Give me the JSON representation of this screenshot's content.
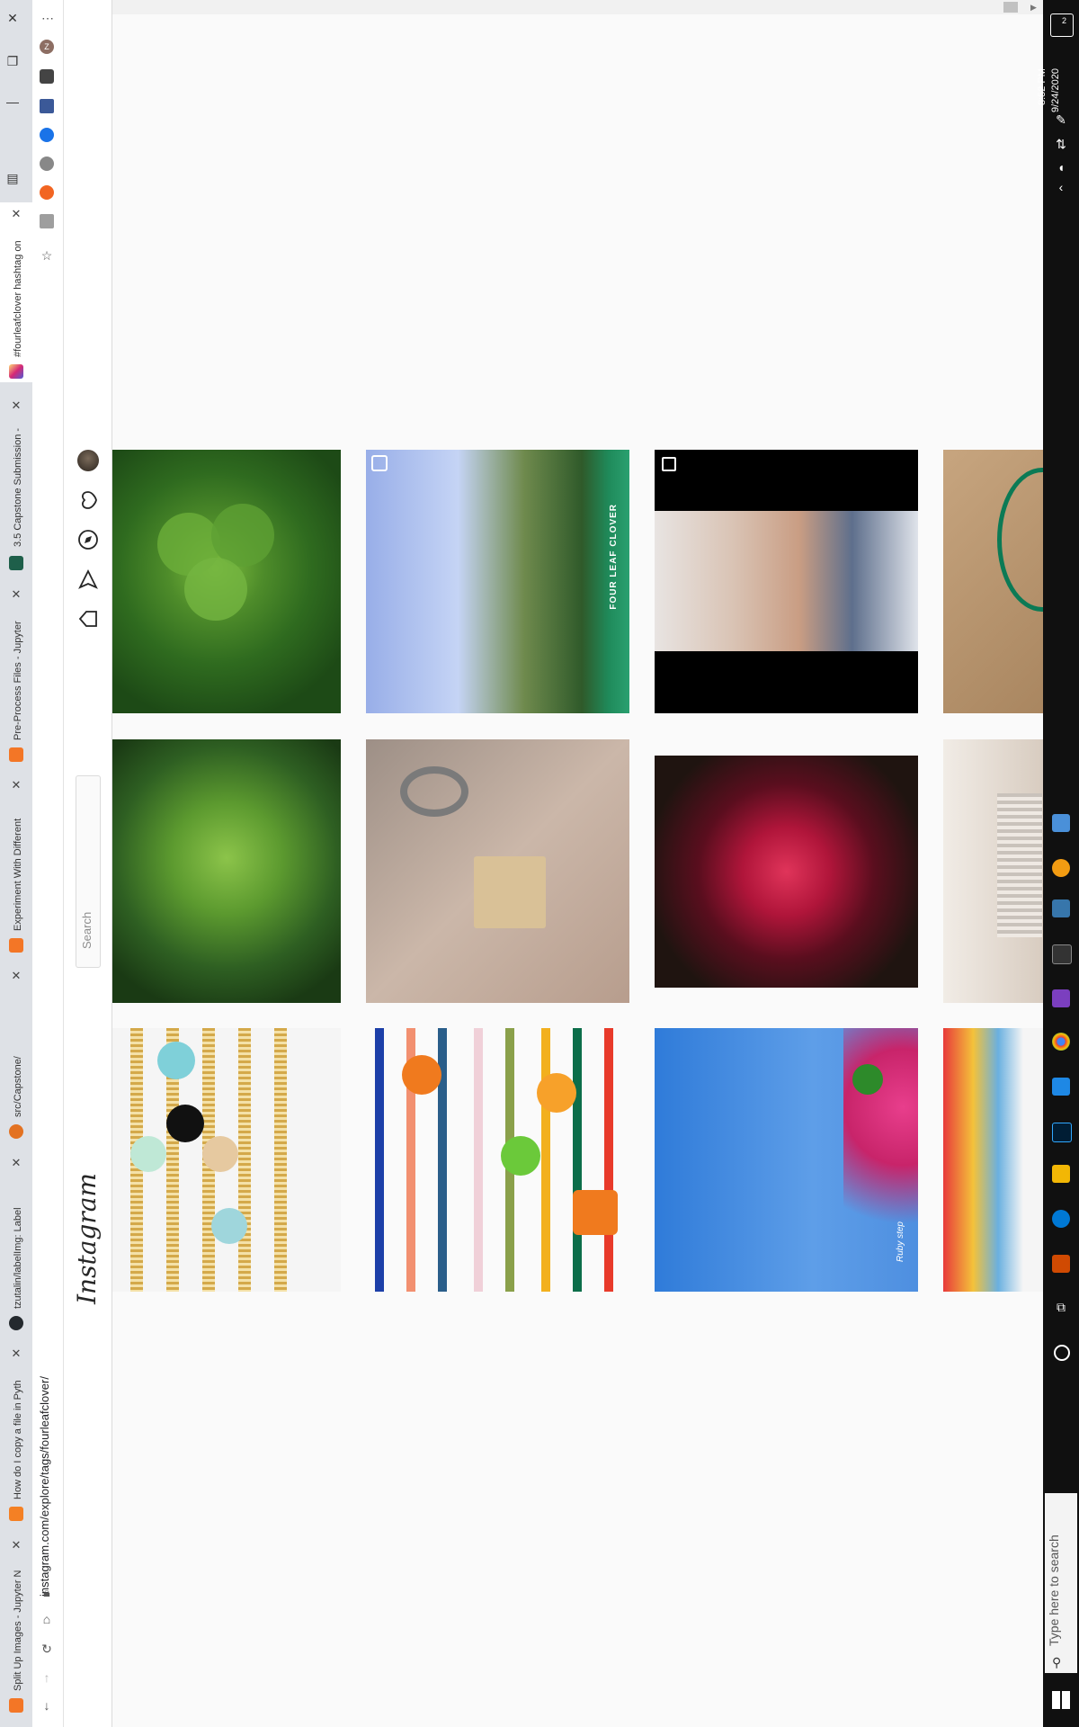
{
  "browser": {
    "tabs": [
      {
        "title": "Split Up Images - Jupyter N"
      },
      {
        "title": "How do I copy a file in Pyth"
      },
      {
        "title": "tzutalin/labelImg: Label"
      },
      {
        "title": "src/Capstone/"
      },
      {
        "title": "Experiment With Different"
      },
      {
        "title": "Pre-Process Files - Jupyter"
      },
      {
        "title": "3.5 Capstone Submission -"
      },
      {
        "title": "#fourleafclover hashtag on"
      }
    ],
    "url": "instagram.com/explore/tags/fourleafclover/",
    "profile_initial": "Z"
  },
  "instagram": {
    "logo": "Instagram",
    "search_placeholder": "Search",
    "tile_text": "FOUR LEAF CLOVER",
    "signature": "Ruby step"
  },
  "taskbar": {
    "search_placeholder": "Type here to search",
    "time": "8:52 PM",
    "date": "9/24/2020",
    "notif_count": "2"
  },
  "colors": {
    "ig_border": "#dbdbdb",
    "taskbar": "#101010",
    "tab_strip": "#dee1e6"
  }
}
